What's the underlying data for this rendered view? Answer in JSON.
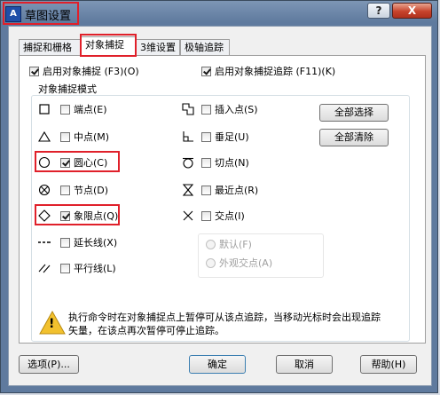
{
  "window": {
    "title": "草图设置",
    "app_icon_text": "A",
    "help_glyph": "?",
    "close_glyph": "X"
  },
  "tabs": [
    {
      "label": "捕捉和栅格"
    },
    {
      "label": "对象捕捉"
    },
    {
      "label": "3维设置"
    },
    {
      "label": "极轴追踪"
    }
  ],
  "panel": {
    "enable_snap_label": "启用对象捕捉 (F3)(O)",
    "enable_snap_checked": true,
    "enable_tracking_label": "启用对象捕捉追踪 (F11)(K)",
    "enable_tracking_checked": true,
    "group_title": "对象捕捉模式",
    "left_modes": [
      {
        "label": "端点(E)",
        "checked": false,
        "icon": "square-endpoint-icon"
      },
      {
        "label": "中点(M)",
        "checked": false,
        "icon": "triangle-midpoint-icon"
      },
      {
        "label": "圆心(C)",
        "checked": true,
        "icon": "circle-center-icon"
      },
      {
        "label": "节点(D)",
        "checked": false,
        "icon": "node-icon"
      },
      {
        "label": "象限点(Q)",
        "checked": true,
        "icon": "diamond-quadrant-icon"
      },
      {
        "label": "延长线(X)",
        "checked": false,
        "icon": "extension-icon"
      },
      {
        "label": "平行线(L)",
        "checked": false,
        "icon": "parallel-icon"
      }
    ],
    "right_modes": [
      {
        "label": "插入点(S)",
        "checked": false,
        "icon": "insert-icon"
      },
      {
        "label": "垂足(U)",
        "checked": false,
        "icon": "perpendicular-icon"
      },
      {
        "label": "切点(N)",
        "checked": false,
        "icon": "tangent-icon"
      },
      {
        "label": "最近点(R)",
        "checked": false,
        "icon": "nearest-icon"
      },
      {
        "label": "交点(I)",
        "checked": false,
        "icon": "intersection-icon"
      }
    ],
    "select_all": "全部选择",
    "clear_all": "全部清除",
    "radio_default": "默认(F)",
    "radio_apparent": "外观交点(A)",
    "warning_text": "执行命令时在对象捕捉点上暂停可从该点追踪，当移动光标时会出现追踪矢量，在该点再次暂停可停止追踪。",
    "warning_glyph": "!"
  },
  "footer": {
    "options": "选项(P)...",
    "ok": "确定",
    "cancel": "取消",
    "help": "帮助(H)"
  },
  "colors": {
    "highlight": "#e0202a",
    "warning": "#f2c12e"
  }
}
